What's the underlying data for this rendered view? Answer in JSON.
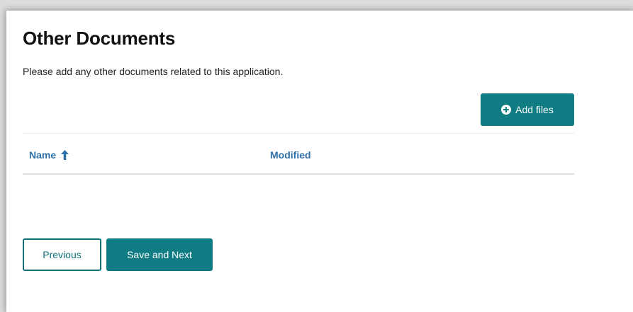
{
  "section": {
    "title": "Other Documents",
    "description": "Please add any other documents related to this application."
  },
  "toolbar": {
    "add_files_label": "Add files",
    "add_files_icon": "plus-circle-icon"
  },
  "table": {
    "columns": [
      {
        "label": "Name",
        "sort": "ascending",
        "sort_icon": "arrow-up-icon"
      },
      {
        "label": "Modified"
      }
    ],
    "rows": []
  },
  "footer": {
    "previous_label": "Previous",
    "save_next_label": "Save and Next"
  },
  "colors": {
    "accent": "#0f7b83",
    "link": "#2f6fa7"
  }
}
